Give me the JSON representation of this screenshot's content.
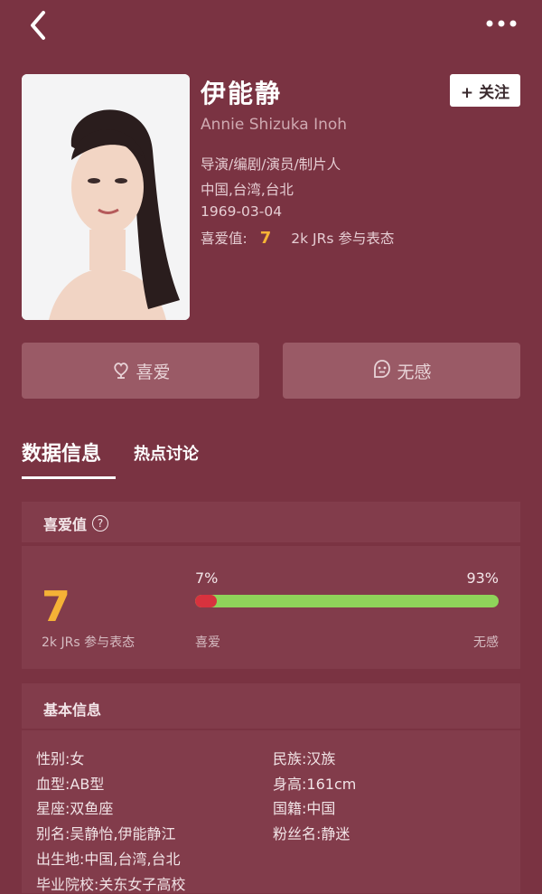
{
  "profile": {
    "name": "伊能静",
    "english_name": "Annie Shizuka Inoh",
    "roles": "导演/编剧/演员/制片人",
    "location": "中国,台湾,台北",
    "birthday": "1969-03-04",
    "rating_label": "喜爱值:",
    "rating_value": "7",
    "participants": "2k JRs 参与表态"
  },
  "actions": {
    "follow_label": "+ 关注",
    "like_label": "喜爱",
    "neutral_label": "无感"
  },
  "tabs": [
    {
      "label": "数据信息",
      "active": true
    },
    {
      "label": "热点讨论",
      "active": false
    }
  ],
  "rating_card": {
    "title": "喜爱值",
    "help_icon": "?",
    "score": "7",
    "participants": "2k JRs 参与表态",
    "like_percent_label": "7%",
    "neutral_percent_label": "93%",
    "like_fraction": 0.07,
    "like_label": "喜爱",
    "neutral_label": "无感",
    "colors": {
      "like": "#d8323e",
      "neutral": "#8fd35a",
      "score": "#f5b236"
    }
  },
  "basic_info": {
    "title": "基本信息",
    "left": [
      {
        "label": "性别:",
        "value": "女"
      },
      {
        "label": "血型:",
        "value": "AB型"
      },
      {
        "label": "星座:",
        "value": "双鱼座"
      },
      {
        "label": "别名:",
        "value": "吴静怡,伊能静江"
      },
      {
        "label": "出生地:",
        "value": "中国,台湾,台北"
      },
      {
        "label": "毕业院校:",
        "value": "关东女子高校"
      }
    ],
    "right": [
      {
        "label": "民族:",
        "value": "汉族"
      },
      {
        "label": "身高:",
        "value": "161cm"
      },
      {
        "label": "国籍:",
        "value": "中国"
      },
      {
        "label": "粉丝名:",
        "value": "静迷"
      }
    ]
  },
  "icons": {
    "back": "back-arrow-icon",
    "more": "more-dots-icon",
    "like": "flower-heart-icon",
    "neutral": "meh-face-icon",
    "help": "question-circle-icon"
  },
  "theme": {
    "background": "#7a3342",
    "card": "#823c4b",
    "button": "#9a5a66"
  }
}
